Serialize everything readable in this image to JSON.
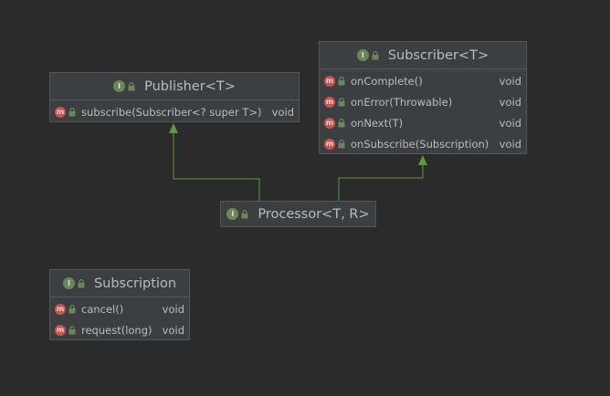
{
  "diagram": {
    "publisher": {
      "title": "Publisher<T>",
      "kind_icon": "interface-icon",
      "members": [
        {
          "name": "subscribe(Subscriber<? super T>)",
          "type": "void"
        }
      ]
    },
    "subscriber": {
      "title": "Subscriber<T>",
      "kind_icon": "interface-icon",
      "members": [
        {
          "name": "onComplete()",
          "type": "void"
        },
        {
          "name": "onError(Throwable)",
          "type": "void"
        },
        {
          "name": "onNext(T)",
          "type": "void"
        },
        {
          "name": "onSubscribe(Subscription)",
          "type": "void"
        }
      ]
    },
    "processor": {
      "title": "Processor<T, R>",
      "kind_icon": "interface-icon"
    },
    "subscription": {
      "title": "Subscription",
      "kind_icon": "interface-icon",
      "members": [
        {
          "name": "cancel()",
          "type": "void"
        },
        {
          "name": "request(long)",
          "type": "void"
        }
      ]
    },
    "icon_glyphs": {
      "interface": "I",
      "method": "m"
    },
    "colors": {
      "background": "#2b2b2b",
      "box_fill": "#3c3f41",
      "box_border": "#555555",
      "text": "#bbbbbb",
      "interface_icon": "#6a8759",
      "method_icon": "#c75450",
      "lock_icon": "#6a8759",
      "arrow": "#5b9b3f"
    }
  }
}
